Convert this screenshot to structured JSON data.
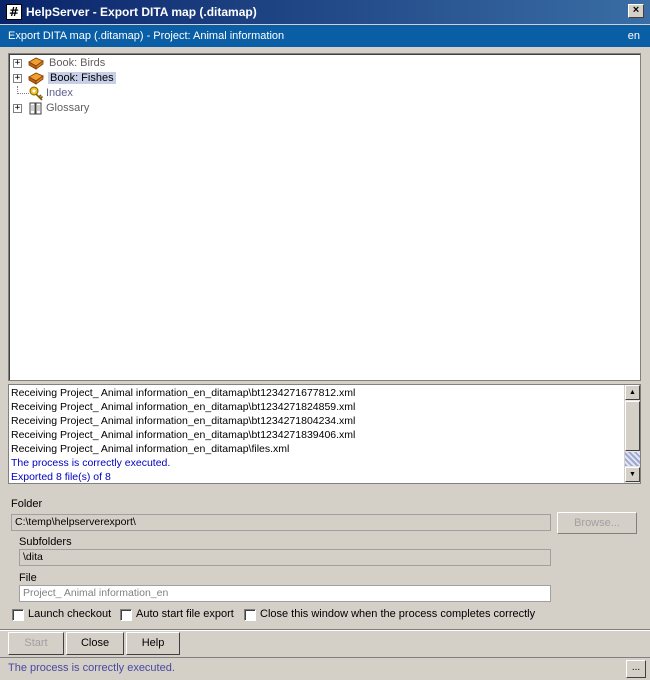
{
  "window": {
    "app_icon": "#",
    "title": "HelpServer - Export DITA map (.ditamap)",
    "close_glyph": "×"
  },
  "header": {
    "title": "Export DITA map (.ditamap) - Project: Animal information",
    "language": "en"
  },
  "tree": {
    "items": [
      {
        "label": "Book: Birds",
        "icon": "book-icon",
        "expandable": true,
        "selected": false
      },
      {
        "label": "Book: Fishes",
        "icon": "book-icon",
        "expandable": true,
        "selected": true
      },
      {
        "label": "Index",
        "icon": "key-icon",
        "expandable": false,
        "selected": false
      },
      {
        "label": "Glossary",
        "icon": "glossary-book-icon",
        "expandable": true,
        "selected": false
      }
    ],
    "expander_glyph": "+"
  },
  "log": {
    "lines": [
      {
        "text": "Receiving Project_ Animal information_en_ditamap\\bt1234271677812.xml",
        "kind": "normal"
      },
      {
        "text": "Receiving Project_ Animal information_en_ditamap\\bt1234271824859.xml",
        "kind": "normal"
      },
      {
        "text": "Receiving Project_ Animal information_en_ditamap\\bt1234271804234.xml",
        "kind": "normal"
      },
      {
        "text": "Receiving Project_ Animal information_en_ditamap\\bt1234271839406.xml",
        "kind": "normal"
      },
      {
        "text": "Receiving Project_ Animal information_en_ditamap\\files.xml",
        "kind": "normal"
      },
      {
        "text": "The process is correctly executed.",
        "kind": "info"
      },
      {
        "text": "Exported 8 file(s) of 8",
        "kind": "info"
      }
    ]
  },
  "form": {
    "folder_label": "Folder",
    "folder_value": "C:\\temp\\helpserverexport\\",
    "browse_label": "Browse...",
    "subfolders_label": "Subfolders",
    "subfolders_value": "\\dita",
    "file_label": "File",
    "file_placeholder": "Project_ Animal information_en"
  },
  "options": {
    "launch_checkout": {
      "label": "Launch checkout",
      "checked": false
    },
    "auto_start_export": {
      "label": "Auto start file export",
      "checked": false
    },
    "close_on_complete": {
      "label": "Close this window when the process completes correctly",
      "checked": false
    }
  },
  "buttons": {
    "start": "Start",
    "close": "Close",
    "help": "Help"
  },
  "status": {
    "text": "The process is correctly executed.",
    "ellipsis": "..."
  },
  "colors": {
    "title_bar": "#0a246a",
    "header_bar": "#0a5ea5",
    "info_text": "#0000c0"
  }
}
